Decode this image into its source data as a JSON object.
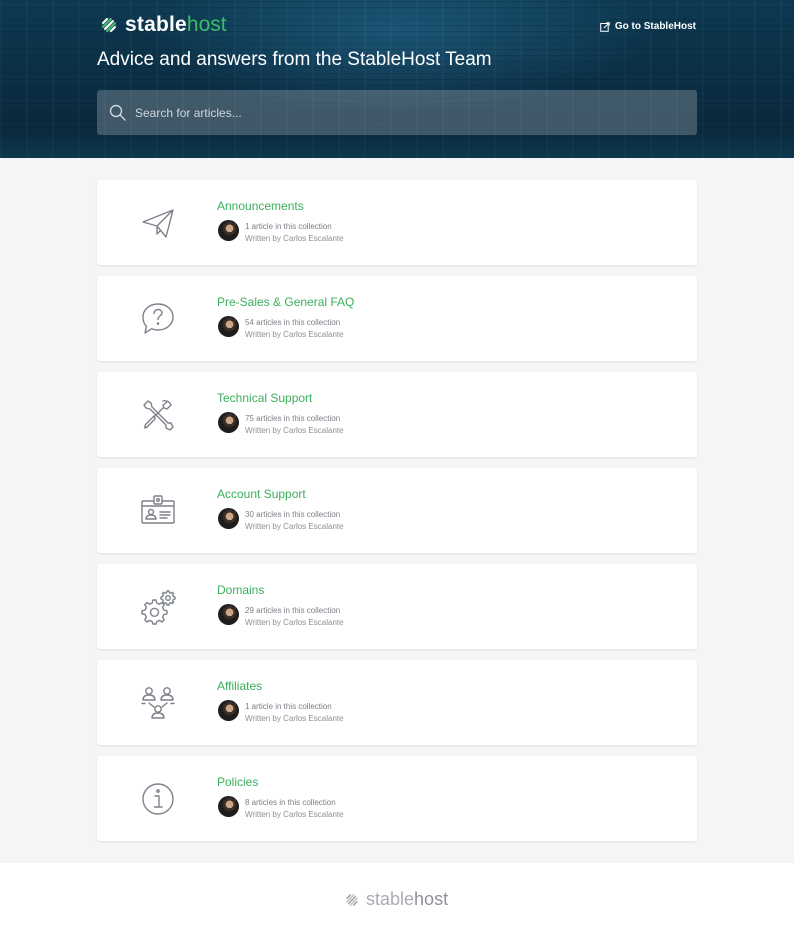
{
  "header": {
    "logo": {
      "word1": "stable",
      "word2": "host",
      "icon": "stablehost-logo-icon"
    },
    "goto_label": "Go to StableHost",
    "headline": "Advice and answers from the StableHost Team",
    "search": {
      "placeholder": "Search for articles...",
      "value": ""
    }
  },
  "collections": [
    {
      "title": "Announcements",
      "count": "1 article in this collection",
      "author": "Written by Carlos Escalante",
      "icon": "paper-plane-icon"
    },
    {
      "title": "Pre-Sales & General FAQ",
      "count": "54 articles in this collection",
      "author": "Written by Carlos Escalante",
      "icon": "question-bubble-icon"
    },
    {
      "title": "Technical Support",
      "count": "75 articles in this collection",
      "author": "Written by Carlos Escalante",
      "icon": "tools-icon"
    },
    {
      "title": "Account Support",
      "count": "30 articles in this collection",
      "author": "Written by Carlos Escalante",
      "icon": "id-card-icon"
    },
    {
      "title": "Domains",
      "count": "29 articles in this collection",
      "author": "Written by Carlos Escalante",
      "icon": "gears-icon"
    },
    {
      "title": "Affiliates",
      "count": "1 article in this collection",
      "author": "Written by Carlos Escalante",
      "icon": "people-network-icon"
    },
    {
      "title": "Policies",
      "count": "8 articles in this collection",
      "author": "Written by Carlos Escalante",
      "icon": "info-circle-icon"
    }
  ],
  "footer": {
    "logo": {
      "word1": "stable",
      "word2": "host"
    }
  },
  "colors": {
    "accent": "#3aaf5c",
    "header_bg": "#0b2e44",
    "page_bg": "#f3f5f7",
    "icon_stroke": "#7d828a"
  }
}
